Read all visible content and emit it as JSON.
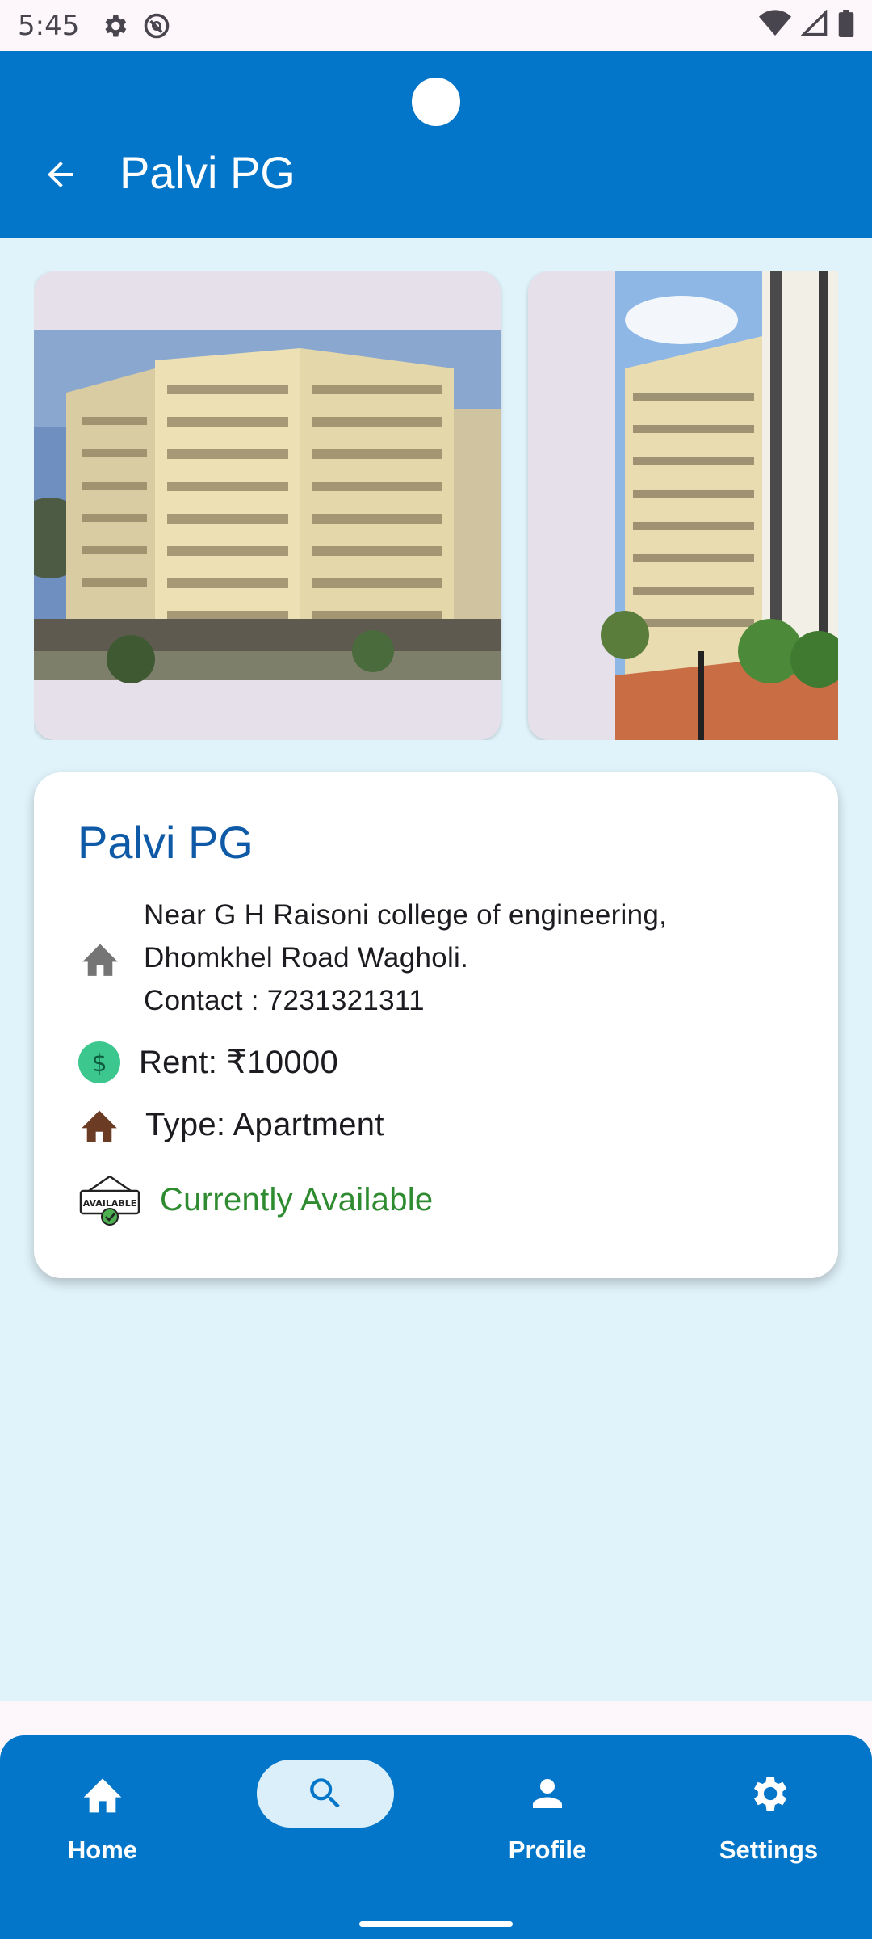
{
  "status_bar": {
    "time": "5:45",
    "left_icons": [
      "gear-icon",
      "do-not-disturb-icon"
    ],
    "right_icons": [
      "wifi-icon",
      "signal-icon",
      "battery-icon"
    ]
  },
  "app_bar": {
    "title": "Palvi PG",
    "back_icon": "arrow-back-icon",
    "color": "#0476c9"
  },
  "gallery": {
    "photos": [
      "apartment-building-photo-1",
      "apartment-building-photo-2"
    ]
  },
  "details": {
    "name": "Palvi PG",
    "address_line1": "Near G H Raisoni college of engineering,",
    "address_line2": "Dhomkhel Road Wagholi.",
    "contact": "Contact : 7231321311",
    "rent": "Rent: ₹10000",
    "type": "Type: Apartment",
    "availability": "Currently Available",
    "availability_badge": "AVAILABLE",
    "availability_color": "#2e8b2f"
  },
  "bottom_nav": {
    "items": [
      {
        "label": "Home",
        "icon": "home-icon"
      },
      {
        "label": "",
        "icon": "search-icon",
        "active": true
      },
      {
        "label": "Profile",
        "icon": "person-icon"
      },
      {
        "label": "Settings",
        "icon": "settings-icon"
      }
    ]
  }
}
